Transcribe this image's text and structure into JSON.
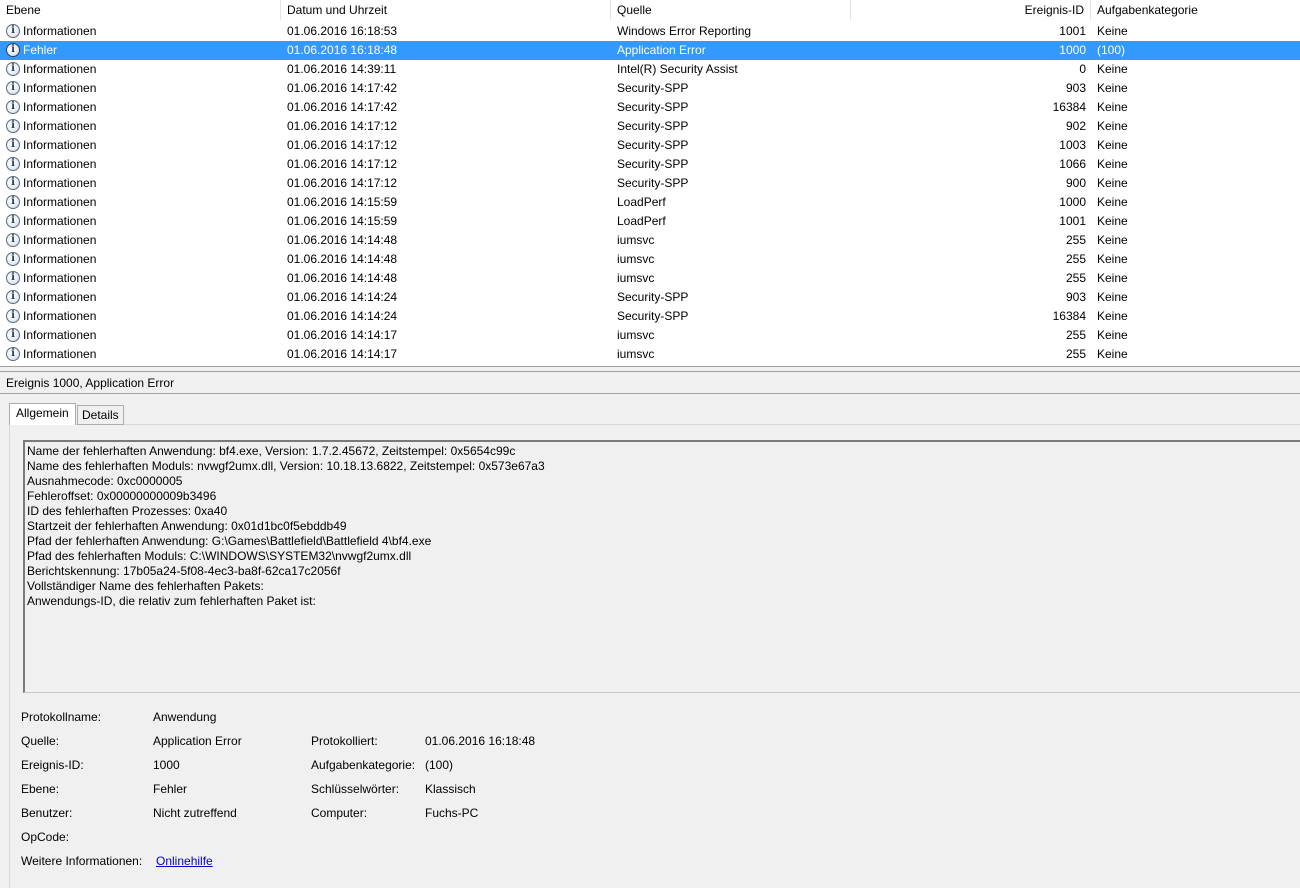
{
  "columns": {
    "level": "Ebene",
    "date": "Datum und Uhrzeit",
    "source": "Quelle",
    "event_id": "Ereignis-ID",
    "category": "Aufgabenkategorie"
  },
  "events": [
    {
      "level": "Informationen",
      "date": "01.06.2016 16:18:53",
      "source": "Windows Error Reporting",
      "id": "1001",
      "category": "Keine",
      "selected": false
    },
    {
      "level": "Fehler",
      "date": "01.06.2016 16:18:48",
      "source": "Application Error",
      "id": "1000",
      "category": "(100)",
      "selected": true
    },
    {
      "level": "Informationen",
      "date": "01.06.2016 14:39:11",
      "source": "Intel(R) Security Assist",
      "id": "0",
      "category": "Keine",
      "selected": false
    },
    {
      "level": "Informationen",
      "date": "01.06.2016 14:17:42",
      "source": "Security-SPP",
      "id": "903",
      "category": "Keine",
      "selected": false
    },
    {
      "level": "Informationen",
      "date": "01.06.2016 14:17:42",
      "source": "Security-SPP",
      "id": "16384",
      "category": "Keine",
      "selected": false
    },
    {
      "level": "Informationen",
      "date": "01.06.2016 14:17:12",
      "source": "Security-SPP",
      "id": "902",
      "category": "Keine",
      "selected": false
    },
    {
      "level": "Informationen",
      "date": "01.06.2016 14:17:12",
      "source": "Security-SPP",
      "id": "1003",
      "category": "Keine",
      "selected": false
    },
    {
      "level": "Informationen",
      "date": "01.06.2016 14:17:12",
      "source": "Security-SPP",
      "id": "1066",
      "category": "Keine",
      "selected": false
    },
    {
      "level": "Informationen",
      "date": "01.06.2016 14:17:12",
      "source": "Security-SPP",
      "id": "900",
      "category": "Keine",
      "selected": false
    },
    {
      "level": "Informationen",
      "date": "01.06.2016 14:15:59",
      "source": "LoadPerf",
      "id": "1000",
      "category": "Keine",
      "selected": false
    },
    {
      "level": "Informationen",
      "date": "01.06.2016 14:15:59",
      "source": "LoadPerf",
      "id": "1001",
      "category": "Keine",
      "selected": false
    },
    {
      "level": "Informationen",
      "date": "01.06.2016 14:14:48",
      "source": "iumsvc",
      "id": "255",
      "category": "Keine",
      "selected": false
    },
    {
      "level": "Informationen",
      "date": "01.06.2016 14:14:48",
      "source": "iumsvc",
      "id": "255",
      "category": "Keine",
      "selected": false
    },
    {
      "level": "Informationen",
      "date": "01.06.2016 14:14:48",
      "source": "iumsvc",
      "id": "255",
      "category": "Keine",
      "selected": false
    },
    {
      "level": "Informationen",
      "date": "01.06.2016 14:14:24",
      "source": "Security-SPP",
      "id": "903",
      "category": "Keine",
      "selected": false
    },
    {
      "level": "Informationen",
      "date": "01.06.2016 14:14:24",
      "source": "Security-SPP",
      "id": "16384",
      "category": "Keine",
      "selected": false
    },
    {
      "level": "Informationen",
      "date": "01.06.2016 14:14:17",
      "source": "iumsvc",
      "id": "255",
      "category": "Keine",
      "selected": false
    },
    {
      "level": "Informationen",
      "date": "01.06.2016 14:14:17",
      "source": "iumsvc",
      "id": "255",
      "category": "Keine",
      "selected": false
    }
  ],
  "row_icon": "info-circle-icon",
  "detail": {
    "title": "Ereignis 1000, Application Error",
    "tabs": {
      "general": "Allgemein",
      "details": "Details"
    },
    "description_lines": [
      "Name der fehlerhaften Anwendung: bf4.exe, Version: 1.7.2.45672, Zeitstempel: 0x5654c99c",
      "Name des fehlerhaften Moduls: nvwgf2umx.dll, Version: 10.18.13.6822, Zeitstempel: 0x573e67a3",
      "Ausnahmecode: 0xc0000005",
      "Fehleroffset: 0x00000000009b3496",
      "ID des fehlerhaften Prozesses: 0xa40",
      "Startzeit der fehlerhaften Anwendung: 0x01d1bc0f5ebddb49",
      "Pfad der fehlerhaften Anwendung: G:\\Games\\Battlefield\\Battlefield 4\\bf4.exe",
      "Pfad des fehlerhaften Moduls: C:\\WINDOWS\\SYSTEM32\\nvwgf2umx.dll",
      "Berichtskennung: 17b05a24-5f08-4ec3-ba8f-62ca17c2056f",
      "Vollständiger Name des fehlerhaften Pakets:",
      "Anwendungs-ID, die relativ zum fehlerhaften Paket ist:"
    ],
    "props": {
      "log_name_label": "Protokollname:",
      "log_name": "Anwendung",
      "source_label": "Quelle:",
      "source": "Application Error",
      "logged_label": "Protokolliert:",
      "logged": "01.06.2016 16:18:48",
      "event_id_label": "Ereignis-ID:",
      "event_id": "1000",
      "task_category_label": "Aufgabenkategorie:",
      "task_category": "(100)",
      "level_label": "Ebene:",
      "level": "Fehler",
      "keywords_label": "Schlüsselwörter:",
      "keywords": "Klassisch",
      "user_label": "Benutzer:",
      "user": "Nicht zutreffend",
      "computer_label": "Computer:",
      "computer": "Fuchs-PC",
      "opcode_label": "OpCode:",
      "opcode": "",
      "more_info_label": "Weitere Informationen:",
      "more_info_link": "Onlinehilfe"
    }
  }
}
